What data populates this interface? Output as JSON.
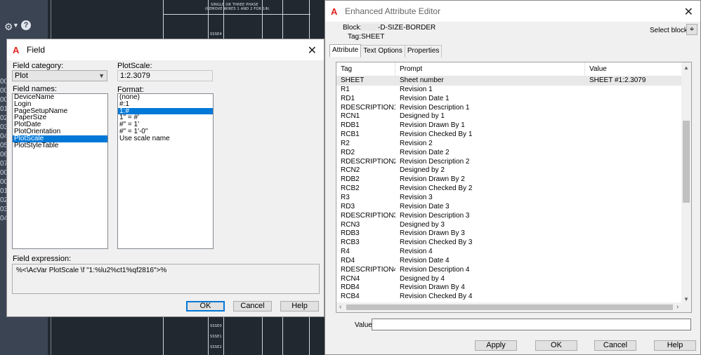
{
  "background": {
    "edge_numbers": [
      "00",
      "00",
      "00",
      "01",
      "02",
      "03",
      "04",
      "05",
      "06",
      "07",
      "00",
      "00",
      "01",
      "02",
      "03",
      "04"
    ],
    "sheet_notes": [
      "SINGLE OR THREE PHASE",
      "(REMOVE WIRES 1 AND 2 FOR 1Φ)",
      "SSSE4",
      "SSSE0",
      "SSSE1",
      "SSSE2"
    ]
  },
  "field_dialog": {
    "title": "Field",
    "category_label": "Field category:",
    "category_value": "Plot",
    "names_label": "Field names:",
    "names": [
      "DeviceName",
      "Login",
      "PageSetupName",
      "PaperSize",
      "PlotDate",
      "PlotOrientation",
      "PlotScale",
      "PlotStyleTable"
    ],
    "selected_name": "PlotScale",
    "plotscale_label": "PlotScale:",
    "plotscale_value": "1:2.3079",
    "format_label": "Format:",
    "formats": [
      "(none)",
      "#:1",
      "1:#",
      "1\" = #'",
      "#\" = 1'",
      "#\" = 1'-0\"",
      "Use scale name"
    ],
    "selected_format": "1:#",
    "expression_label": "Field expression:",
    "expression": "%<\\AcVar PlotScale \\f \"1:%lu2%ct1%qf2816\">%",
    "buttons": {
      "ok": "OK",
      "cancel": "Cancel",
      "help": "Help"
    }
  },
  "attr_editor": {
    "title": "Enhanced Attribute Editor",
    "block_label": "Block:",
    "block_value": "-D-SIZE-BORDER",
    "tag_label": "Tag:",
    "tag_value": "SHEET",
    "select_block_label": "Select block",
    "tabs": [
      "Attribute",
      "Text Options",
      "Properties"
    ],
    "columns": [
      "Tag",
      "Prompt",
      "Value"
    ],
    "rows": [
      {
        "tag": "SHEET",
        "prompt": "Sheet number",
        "value": "SHEET #1:2.3079"
      },
      {
        "tag": "R1",
        "prompt": "Revision 1",
        "value": ""
      },
      {
        "tag": "RD1",
        "prompt": "Revision Date 1",
        "value": ""
      },
      {
        "tag": "RDESCRIPTION1",
        "prompt": "Revision Description 1",
        "value": ""
      },
      {
        "tag": "RCN1",
        "prompt": "Designed by 1",
        "value": ""
      },
      {
        "tag": "RDB1",
        "prompt": "Revision Drawn By 1",
        "value": ""
      },
      {
        "tag": "RCB1",
        "prompt": "Revision Checked By 1",
        "value": ""
      },
      {
        "tag": "R2",
        "prompt": "Revision 2",
        "value": ""
      },
      {
        "tag": "RD2",
        "prompt": "Revision Date 2",
        "value": ""
      },
      {
        "tag": "RDESCRIPTION2",
        "prompt": "Revision Description 2",
        "value": ""
      },
      {
        "tag": "RCN2",
        "prompt": "Designed by 2",
        "value": ""
      },
      {
        "tag": "RDB2",
        "prompt": "Revision Drawn By 2",
        "value": ""
      },
      {
        "tag": "RCB2",
        "prompt": "Revision Checked By 2",
        "value": ""
      },
      {
        "tag": "R3",
        "prompt": "Revision 3",
        "value": ""
      },
      {
        "tag": "RD3",
        "prompt": "Revision Date 3",
        "value": ""
      },
      {
        "tag": "RDESCRIPTION3",
        "prompt": "Revision Description 3",
        "value": ""
      },
      {
        "tag": "RCN3",
        "prompt": "Designed by 3",
        "value": ""
      },
      {
        "tag": "RDB3",
        "prompt": "Revision Drawn By 3",
        "value": ""
      },
      {
        "tag": "RCB3",
        "prompt": "Revision Checked By 3",
        "value": ""
      },
      {
        "tag": "R4",
        "prompt": "Revision 4",
        "value": ""
      },
      {
        "tag": "RD4",
        "prompt": "Revision Date 4",
        "value": ""
      },
      {
        "tag": "RDESCRIPTION4",
        "prompt": "Revision Description 4",
        "value": ""
      },
      {
        "tag": "RCN4",
        "prompt": "Designed by 4",
        "value": ""
      },
      {
        "tag": "RDB4",
        "prompt": "Revision Drawn By 4",
        "value": ""
      },
      {
        "tag": "RCB4",
        "prompt": "Revision Checked By 4",
        "value": ""
      }
    ],
    "value_label": "Value:",
    "value_field": "",
    "buttons": {
      "apply": "Apply",
      "ok": "OK",
      "cancel": "Cancel",
      "help": "Help"
    }
  },
  "colors": {
    "selection": "#0078d7",
    "autodesk_red": "#e0211d",
    "dialog_bg": "#f0f0f0",
    "cad_bg": "#212830"
  }
}
